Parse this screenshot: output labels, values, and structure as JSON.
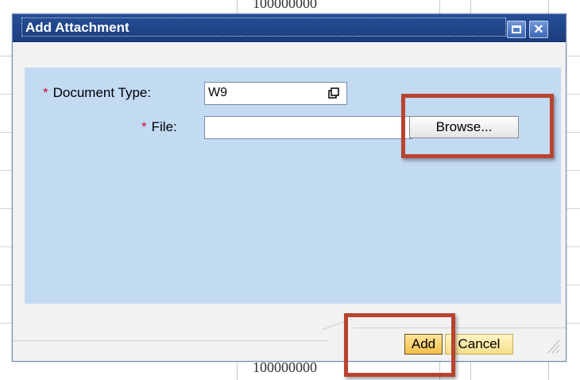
{
  "background": {
    "top_text": "100000000",
    "bottom_text": "100000000"
  },
  "dialog": {
    "title": "Add Attachment",
    "maximize_icon": "maximize-icon",
    "close_icon": "close-icon",
    "fields": {
      "document_type_label": "Document Type:",
      "document_type_value": "W9",
      "file_label": "File:",
      "file_value": "",
      "required_marker": "*"
    },
    "browse_label": "Browse...",
    "add_label": "Add",
    "cancel_label": "Cancel"
  },
  "colors": {
    "title_bar": "#1f4587",
    "panel": "#c3daf3",
    "highlight": "#b8432f",
    "primary_button": "#f6c04a"
  }
}
